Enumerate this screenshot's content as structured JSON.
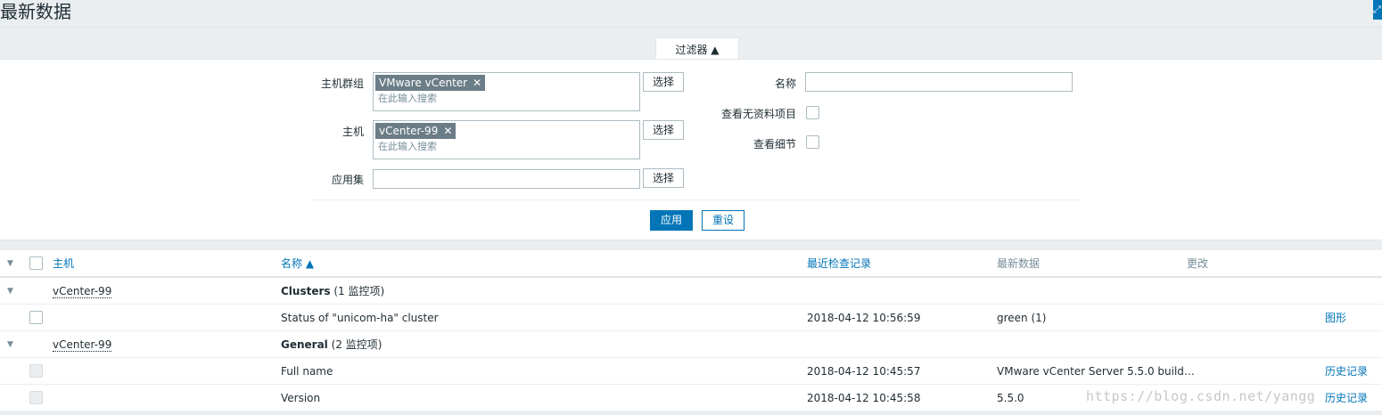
{
  "header": {
    "title": "最新数据",
    "fullscreen_icon": "fullscreen-icon"
  },
  "filter": {
    "tab_label": "过滤器 ▲",
    "host_group": {
      "label": "主机群组",
      "tag": "VMware vCenter",
      "placeholder": "在此输入搜索",
      "button": "选择"
    },
    "host": {
      "label": "主机",
      "tag": "vCenter-99",
      "placeholder": "在此输入搜索",
      "button": "选择"
    },
    "application": {
      "label": "应用集",
      "value": "",
      "button": "选择"
    },
    "name": {
      "label": "名称",
      "value": ""
    },
    "show_items_without_data": {
      "label": "查看无资料项目",
      "checked": false
    },
    "show_details": {
      "label": "查看细节",
      "checked": false
    },
    "apply_label": "应用",
    "reset_label": "重设"
  },
  "table": {
    "columns": {
      "host": "主机",
      "name": "名称 ▲",
      "last_check": "最近检查记录",
      "last_value": "最新数据",
      "change": "更改"
    },
    "groups": [
      {
        "host": "vCenter-99",
        "app_name": "Clusters",
        "app_count": "(1 监控项)",
        "items": [
          {
            "name": "Status of \"unicom-ha\" cluster",
            "last_check": "2018-04-12 10:56:59",
            "last_value": "green (1)",
            "action": "图形"
          }
        ]
      },
      {
        "host": "vCenter-99",
        "app_name": "General",
        "app_count": "(2 监控项)",
        "items": [
          {
            "name": "Full name",
            "last_check": "2018-04-12 10:45:57",
            "last_value": "VMware vCenter Server 5.5.0 build…",
            "action": "历史记录"
          },
          {
            "name": "Version",
            "last_check": "2018-04-12 10:45:58",
            "last_value": "5.5.0",
            "action": "历史记录"
          }
        ]
      }
    ]
  },
  "watermark": "https://blog.csdn.net/yangg",
  "colors": {
    "accent": "#0275b8",
    "tag_bg": "#6b7d86",
    "page_bg": "#ebeef0"
  }
}
